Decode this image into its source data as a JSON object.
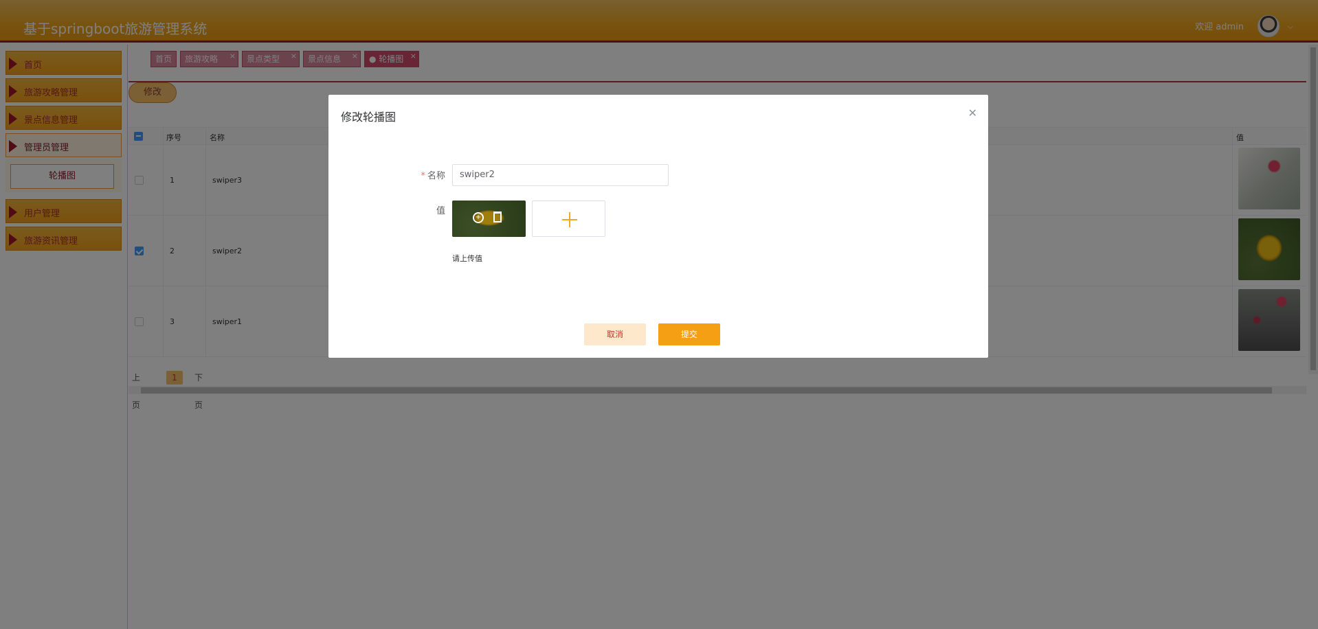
{
  "header": {
    "app_title": "基于springboot旅游管理系统",
    "welcome": "欢迎 admin",
    "avatar_icon": "user-avatar",
    "caret_icon": "chevron-down-icon"
  },
  "sidebar": {
    "items": [
      {
        "label": "首页"
      },
      {
        "label": "旅游攻略管理"
      },
      {
        "label": "景点信息管理"
      },
      {
        "label": "管理员管理"
      },
      {
        "label": "用户管理"
      },
      {
        "label": "旅游资讯管理"
      }
    ],
    "submenu": {
      "label": "轮播图"
    }
  },
  "tabs": [
    {
      "label": "首页"
    },
    {
      "label": "旅游攻略"
    },
    {
      "label": "景点类型"
    },
    {
      "label": "景点信息"
    },
    {
      "label": "● 轮播图"
    }
  ],
  "toolbar": {
    "edit_label": "修改"
  },
  "table": {
    "headers": {
      "index": "序号",
      "name": "名称",
      "value": "值"
    },
    "rows": [
      {
        "index": "1",
        "name": "swiper3",
        "checked": false,
        "image": "pink-flower"
      },
      {
        "index": "2",
        "name": "swiper2",
        "checked": true,
        "image": "yellow-flower"
      },
      {
        "index": "3",
        "name": "swiper1",
        "checked": false,
        "image": "red-blossoms"
      }
    ]
  },
  "pager": {
    "prev": "上一页",
    "current": "1",
    "next": "下一页"
  },
  "dialog": {
    "title": "修改轮播图",
    "name_label": "名称",
    "required_mark": "*",
    "name_value": "swiper2",
    "value_label": "值",
    "tip": "请上传值",
    "cancel_label": "取消",
    "submit_label": "提交"
  },
  "colors": {
    "header": "#f1a71f",
    "accent": "#f5a014",
    "tab": "#ce4b6d",
    "menu_arrow": "#a3162e"
  }
}
